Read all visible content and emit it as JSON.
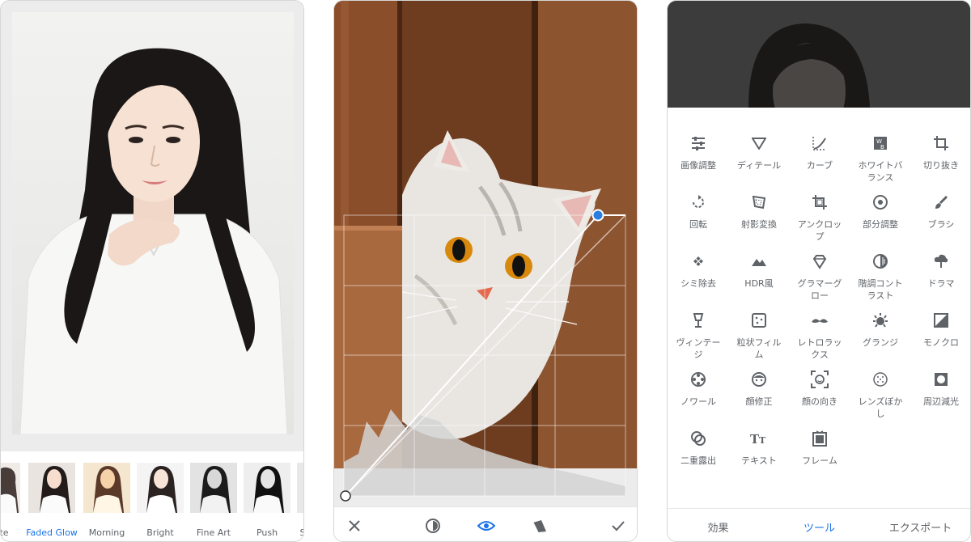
{
  "phone1": {
    "filters": [
      {
        "label": "tuate"
      },
      {
        "label": "Faded Glow",
        "selected": true
      },
      {
        "label": "Morning"
      },
      {
        "label": "Bright"
      },
      {
        "label": "Fine Art"
      },
      {
        "label": "Push"
      },
      {
        "label": "S"
      }
    ]
  },
  "phone2": {
    "toolbar": {
      "icons": [
        "close-icon",
        "auto-adjust-icon",
        "eye-icon",
        "presets-icon",
        "check-icon"
      ]
    },
    "accent": "#1a73e8"
  },
  "phone3": {
    "tools": [
      "画像調整",
      "ディテール",
      "カーブ",
      "ホワイトバランス",
      "切り抜き",
      "回転",
      "射影変換",
      "アンクロップ",
      "部分調整",
      "ブラシ",
      "シミ除去",
      "HDR風",
      "グラマーグロー",
      "階調コントラスト",
      "ドラマ",
      "ヴィンテージ",
      "粒状フィルム",
      "レトロラックス",
      "グランジ",
      "モノクロ",
      "ノワール",
      "顔修正",
      "顔の向き",
      "レンズぼかし",
      "周辺減光",
      "二重露出",
      "テキスト",
      "フレーム"
    ],
    "tabs": [
      "効果",
      "ツール",
      "エクスポート"
    ],
    "active_tab": "ツール"
  }
}
